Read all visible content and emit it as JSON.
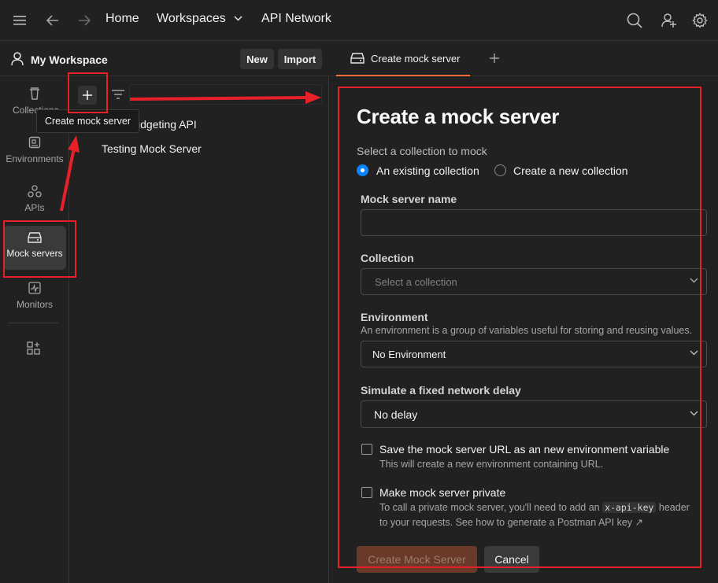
{
  "topbar": {
    "home": "Home",
    "workspaces": "Workspaces",
    "api_network": "API Network"
  },
  "workspace": {
    "name": "My Workspace",
    "new_label": "New",
    "import_label": "Import"
  },
  "rail": {
    "items": [
      {
        "label": "Collections",
        "icon": "trash-icon"
      },
      {
        "label": "Environments",
        "icon": "environment-icon"
      },
      {
        "label": "APIs",
        "icon": "apis-icon"
      },
      {
        "label": "Mock servers",
        "icon": "mock-server-icon",
        "active": true
      },
      {
        "label": "Monitors",
        "icon": "monitor-icon"
      }
    ]
  },
  "list": {
    "items": [
      "Budgeting API",
      "Testing Mock Server"
    ],
    "tooltip": "Create mock server"
  },
  "tab": {
    "label": "Create mock server"
  },
  "form": {
    "title": "Create a mock server",
    "select_collection_label": "Select a collection to mock",
    "radio_existing": "An existing collection",
    "radio_new": "Create a new collection",
    "radio_selected": "existing",
    "name_label": "Mock server name",
    "name_value": "",
    "collection_label": "Collection",
    "collection_placeholder": "Select a collection",
    "environment_label": "Environment",
    "environment_help": "An environment is a group of variables useful for storing and reusing values.",
    "environment_value": "No Environment",
    "delay_label": "Simulate a fixed network delay",
    "delay_value": "No delay",
    "save_url_label": "Save the mock server URL as an new environment variable",
    "save_url_help": "This will create a new environment containing URL.",
    "private_label": "Make mock server private",
    "private_help_before": "To call a private mock server, you'll need to add an",
    "private_help_code": "x-api-key",
    "private_help_after": "header",
    "private_help_line2": "to your requests. See how to generate a Postman API key ↗",
    "create_button": "Create Mock Server",
    "cancel_button": "Cancel"
  },
  "colors": {
    "background": "#212121",
    "accent": "#ff6c37",
    "radio_selected": "#0a84ff",
    "annotation": "#e8202a"
  }
}
